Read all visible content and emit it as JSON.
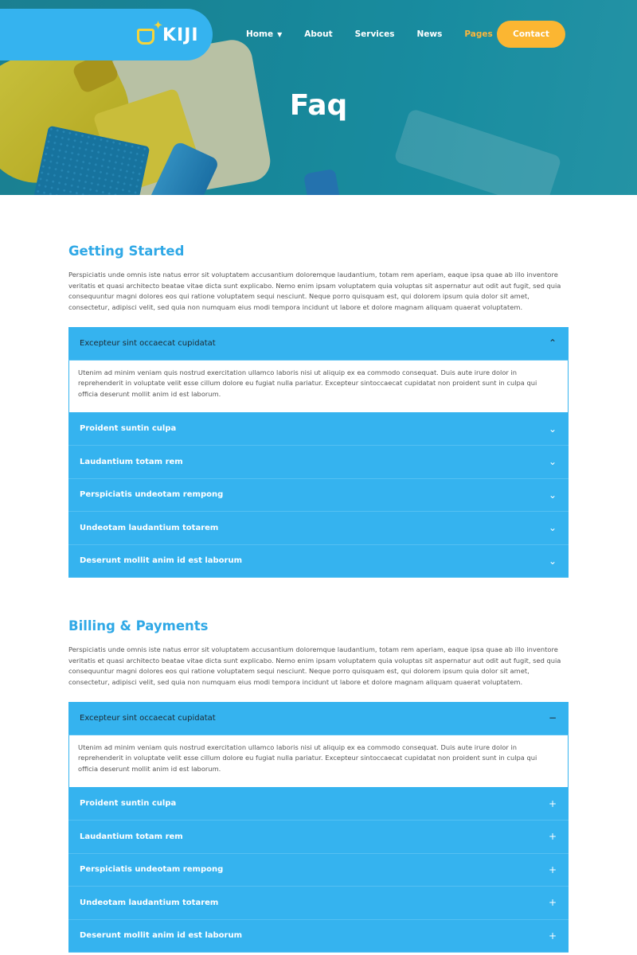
{
  "header": {
    "logo_text": "KIJI",
    "nav": [
      {
        "label": "Home",
        "has_dropdown": true,
        "active": false
      },
      {
        "label": "About",
        "has_dropdown": false,
        "active": false
      },
      {
        "label": "Services",
        "has_dropdown": false,
        "active": false
      },
      {
        "label": "News",
        "has_dropdown": false,
        "active": false
      },
      {
        "label": "Pages",
        "has_dropdown": true,
        "active": true
      }
    ],
    "contact_label": "Contact",
    "page_title": "Faq"
  },
  "colors": {
    "accent_blue": "#35b3ef",
    "heading_blue": "#2fa8e6",
    "accent_yellow": "#fbb632",
    "hero_teal": "#1a98ab"
  },
  "sections": [
    {
      "title": "Getting Started",
      "intro": "Perspiciatis unde omnis iste natus error sit voluptatem accusantium doloremque laudantium, totam rem aperiam, eaque ipsa quae ab illo inventore veritatis et quasi architecto beatae vitae dicta sunt explicabo. Nemo enim ipsam voluptatem quia voluptas sit aspernatur aut odit aut fugit, sed quia consequuntur magni dolores eos qui ratione voluptatem sequi nesciunt. Neque porro quisquam est, qui dolorem ipsum quia dolor sit amet, consectetur, adipisci velit, sed quia non numquam eius modi tempora incidunt ut labore et dolore magnam aliquam quaerat voluptatem.",
      "icon_open": "chevron-up-icon",
      "icon_closed": "chevron-down-icon",
      "items": [
        {
          "question": "Excepteur sint occaecat cupidatat",
          "open": true,
          "answer": "Utenim ad minim veniam quis nostrud exercitation ullamco laboris nisi ut aliquip ex ea commodo consequat. Duis aute irure dolor in reprehenderit in voluptate velit esse cillum dolore eu fugiat nulla pariatur. Excepteur sintoccaecat cupidatat non proident sunt in culpa qui officia deserunt mollit anim id est laborum."
        },
        {
          "question": "Proident suntin culpa",
          "open": false
        },
        {
          "question": "Laudantium totam rem",
          "open": false
        },
        {
          "question": "Perspiciatis undeotam rempong",
          "open": false
        },
        {
          "question": "Undeotam laudantium totarem",
          "open": false
        },
        {
          "question": "Deserunt mollit anim id est laborum",
          "open": false
        }
      ]
    },
    {
      "title": "Billing & Payments",
      "intro": "Perspiciatis unde omnis iste natus error sit voluptatem accusantium doloremque laudantium, totam rem aperiam, eaque ipsa quae ab illo inventore veritatis et quasi architecto beatae vitae dicta sunt explicabo. Nemo enim ipsam voluptatem quia voluptas sit aspernatur aut odit aut fugit, sed quia consequuntur magni dolores eos qui ratione voluptatem sequi nesciunt. Neque porro quisquam est, qui dolorem ipsum quia dolor sit amet, consectetur, adipisci velit, sed quia non numquam eius modi tempora incidunt ut labore et dolore magnam aliquam quaerat voluptatem.",
      "icon_open": "minus-icon",
      "icon_closed": "plus-icon",
      "items": [
        {
          "question": "Excepteur sint occaecat cupidatat",
          "open": true,
          "answer": "Utenim ad minim veniam quis nostrud exercitation ullamco laboris nisi ut aliquip ex ea commodo consequat. Duis aute irure dolor in reprehenderit in voluptate velit esse cillum dolore eu fugiat nulla pariatur. Excepteur sintoccaecat cupidatat non proident sunt in culpa qui officia deserunt mollit anim id est laborum."
        },
        {
          "question": "Proident suntin culpa",
          "open": false
        },
        {
          "question": "Laudantium totam rem",
          "open": false
        },
        {
          "question": "Perspiciatis undeotam rempong",
          "open": false
        },
        {
          "question": "Undeotam laudantium totarem",
          "open": false
        },
        {
          "question": "Deserunt mollit anim id est laborum",
          "open": false
        }
      ]
    }
  ]
}
